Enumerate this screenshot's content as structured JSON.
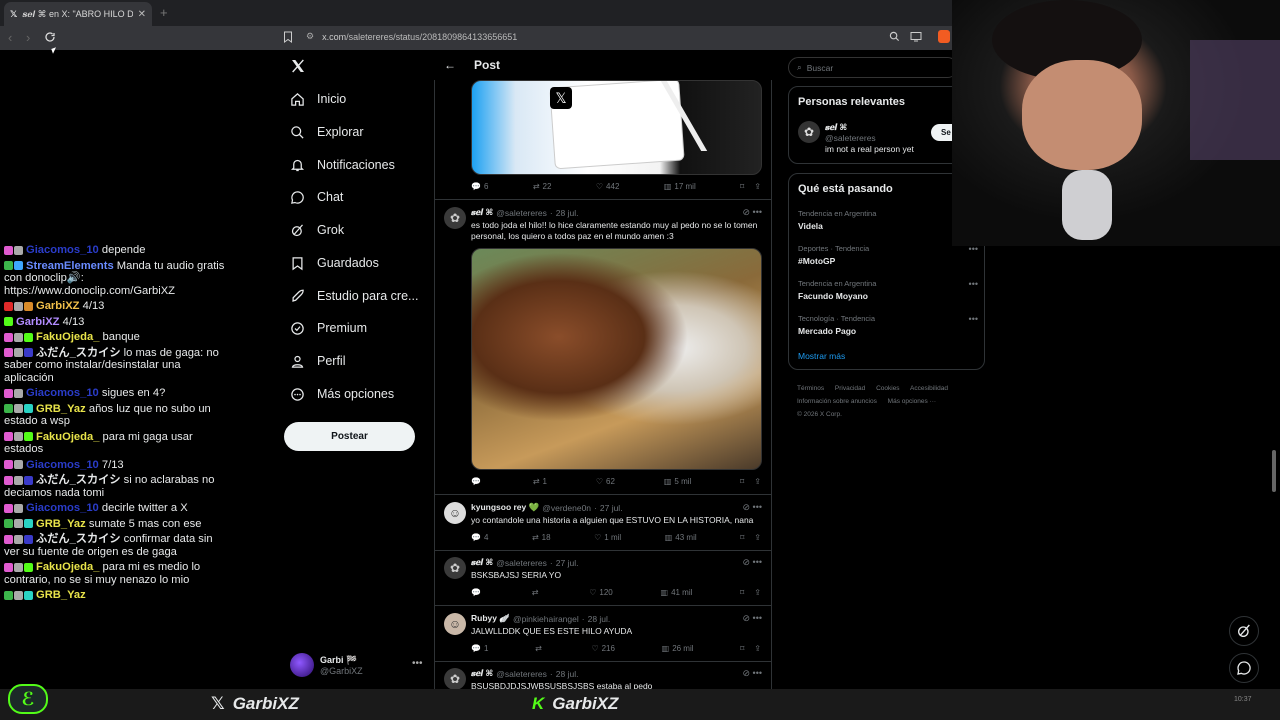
{
  "browser": {
    "tab_title": "𝒔𝒆𝒍 ⌘ en X: \"ABRO HILO DE TO",
    "url_host": "x.com",
    "url_path": "/saletereres/status/2081809864133656651"
  },
  "chat": [
    {
      "user": "Giacomos_10",
      "color": "#2a3cc9",
      "text": "depende",
      "badges": [
        "#e05bd0",
        "#aaaaaa"
      ]
    },
    {
      "user": "StreamElements",
      "color": "#6a8cff",
      "text": "Manda tu audio gratis con donoclip🔊: https://www.donoclip.com/GarbiXZ",
      "badges": [
        "#3bb54a",
        "#3ea6ff"
      ]
    },
    {
      "user": "GarbiXZ",
      "color": "#f2c04a",
      "text": "4/13",
      "badges": [
        "#e02a2a",
        "#aaaaaa",
        "#d88b2a"
      ]
    },
    {
      "user": "GarbiXZ",
      "color": "#b28cff",
      "text": "4/13",
      "badges": [
        "#53fc18"
      ]
    },
    {
      "user": "FakuOjeda_",
      "color": "#e8e34a",
      "text": "banque",
      "badges": [
        "#e05bd0",
        "#aaaaaa",
        "#53fc18"
      ]
    },
    {
      "user": "ふだん_スカイシ",
      "color": "#e7e9ea",
      "text": "lo mas de gaga: no saber como instalar/desinstalar una aplicación",
      "badges": [
        "#e05bd0",
        "#aaaaaa",
        "#3a3ac9"
      ]
    },
    {
      "user": "Giacomos_10",
      "color": "#2a3cc9",
      "text": "sigues en 4?",
      "badges": [
        "#e05bd0",
        "#aaaaaa"
      ]
    },
    {
      "user": "GRB_Yaz",
      "color": "#e8e34a",
      "text": "años luz que no subo un estado a wsp",
      "badges": [
        "#3bb54a",
        "#aaaaaa",
        "#2ad3c4"
      ]
    },
    {
      "user": "FakuOjeda_",
      "color": "#e8e34a",
      "text": "para mi gaga usar estados",
      "badges": [
        "#e05bd0",
        "#aaaaaa",
        "#53fc18"
      ]
    },
    {
      "user": "Giacomos_10",
      "color": "#2a3cc9",
      "text": "7/13",
      "badges": [
        "#e05bd0",
        "#aaaaaa"
      ]
    },
    {
      "user": "ふだん_スカイシ",
      "color": "#e7e9ea",
      "text": "si no aclarabas no deciamos nada tomi",
      "badges": [
        "#e05bd0",
        "#aaaaaa",
        "#3a3ac9"
      ]
    },
    {
      "user": "Giacomos_10",
      "color": "#2a3cc9",
      "text": "decirle twitter a X",
      "badges": [
        "#e05bd0",
        "#aaaaaa"
      ]
    },
    {
      "user": "GRB_Yaz",
      "color": "#e8e34a",
      "text": "sumate 5 mas con ese",
      "badges": [
        "#3bb54a",
        "#aaaaaa",
        "#2ad3c4"
      ]
    },
    {
      "user": "ふだん_スカイシ",
      "color": "#e7e9ea",
      "text": "confirmar data sin ver su fuente de origen es de gaga",
      "badges": [
        "#e05bd0",
        "#aaaaaa",
        "#3a3ac9"
      ]
    },
    {
      "user": "FakuOjeda_",
      "color": "#e8e34a",
      "text": "para mi es medio lo contrario, no se si muy nenazo lo mio",
      "badges": [
        "#e05bd0",
        "#aaaaaa",
        "#53fc18"
      ]
    },
    {
      "user": "GRB_Yaz",
      "color": "#e8e34a",
      "text": "",
      "badges": [
        "#3bb54a",
        "#aaaaaa",
        "#2ad3c4"
      ]
    }
  ],
  "nav": {
    "items": [
      "Inicio",
      "Explorar",
      "Notificaciones",
      "Chat",
      "Grok",
      "Guardados",
      "Estudio para cre...",
      "Premium",
      "Perfil",
      "Más opciones"
    ],
    "post_button": "Postear",
    "me_name": "Garbi 🏁",
    "me_handle": "@GarbiXZ"
  },
  "header": {
    "title": "Post"
  },
  "first_actions": {
    "replies": "6",
    "reposts": "22",
    "likes": "442",
    "views": "17 mil"
  },
  "tweets": [
    {
      "name": "𝒔𝒆𝒍 ⌘",
      "handle": "@saletereres",
      "date": "28 jul.",
      "text": "es todo joda el hilo!! lo hice claramente estando muy al pedo no se lo tomen personal, los quiero a todos paz en el mundo amen :3",
      "replies": "",
      "reposts": "1",
      "likes": "62",
      "views": "5 mil"
    },
    {
      "name": "kyungsoo rey 💚",
      "handle": "@verdene0n",
      "date": "27 jul.",
      "text": "yo contandole una historia a alguien que ESTUVO EN LA HISTORIA, nana",
      "replies": "4",
      "reposts": "18",
      "likes": "1 mil",
      "views": "43 mil"
    },
    {
      "name": "𝒔𝒆𝒍 ⌘",
      "handle": "@saletereres",
      "date": "27 jul.",
      "text": "BSKSBAJSJ SERIA YO",
      "replies": "",
      "reposts": "",
      "likes": "120",
      "views": "41 mil"
    },
    {
      "name": "Rubyy 🪽",
      "handle": "@pinkiehairangel",
      "date": "28 jul.",
      "text": "JALWLLDDK QUE ES ESTE HILO AYUDA",
      "replies": "1",
      "reposts": "",
      "likes": "216",
      "views": "26 mil"
    },
    {
      "name": "𝒔𝒆𝒍 ⌘",
      "handle": "@saletereres",
      "date": "28 jul.",
      "text": "BSUSBDJDJSJWBSUSBSJSBS estaba al pedo",
      "replies": "",
      "reposts": "",
      "likes": "",
      "views": ""
    }
  ],
  "right": {
    "search_placeholder": "Buscar",
    "relevant_title": "Personas relevantes",
    "rel_name": "𝒔𝒆𝒍 ⌘",
    "rel_handle": "@saletereres",
    "rel_bio": "im not a real person yet",
    "rel_follow": "Se",
    "trend_title": "Qué está pasando",
    "trends": [
      {
        "context": "Tendencia en Argentina",
        "name": "Videla"
      },
      {
        "context": "Deportes · Tendencia",
        "name": "#MotoGP"
      },
      {
        "context": "Tendencia en Argentina",
        "name": "Facundo Moyano"
      },
      {
        "context": "Tecnología · Tendencia",
        "name": "Mercado Pago"
      }
    ],
    "show_more": "Mostrar más",
    "footer": [
      "Términos",
      "Privacidad",
      "Cookies",
      "Accesibilidad",
      "Información sobre anuncios",
      "Más opciones ···",
      "© 2026 X Corp."
    ]
  },
  "bottom": {
    "x_name": "GarbiXZ",
    "kick_name": "GarbiXZ",
    "time_partial": "10:37"
  },
  "colors": {
    "kick_green": "#53fc18",
    "x_blue": "#1d9bf0",
    "post_button_bg": "#eff3f4"
  }
}
